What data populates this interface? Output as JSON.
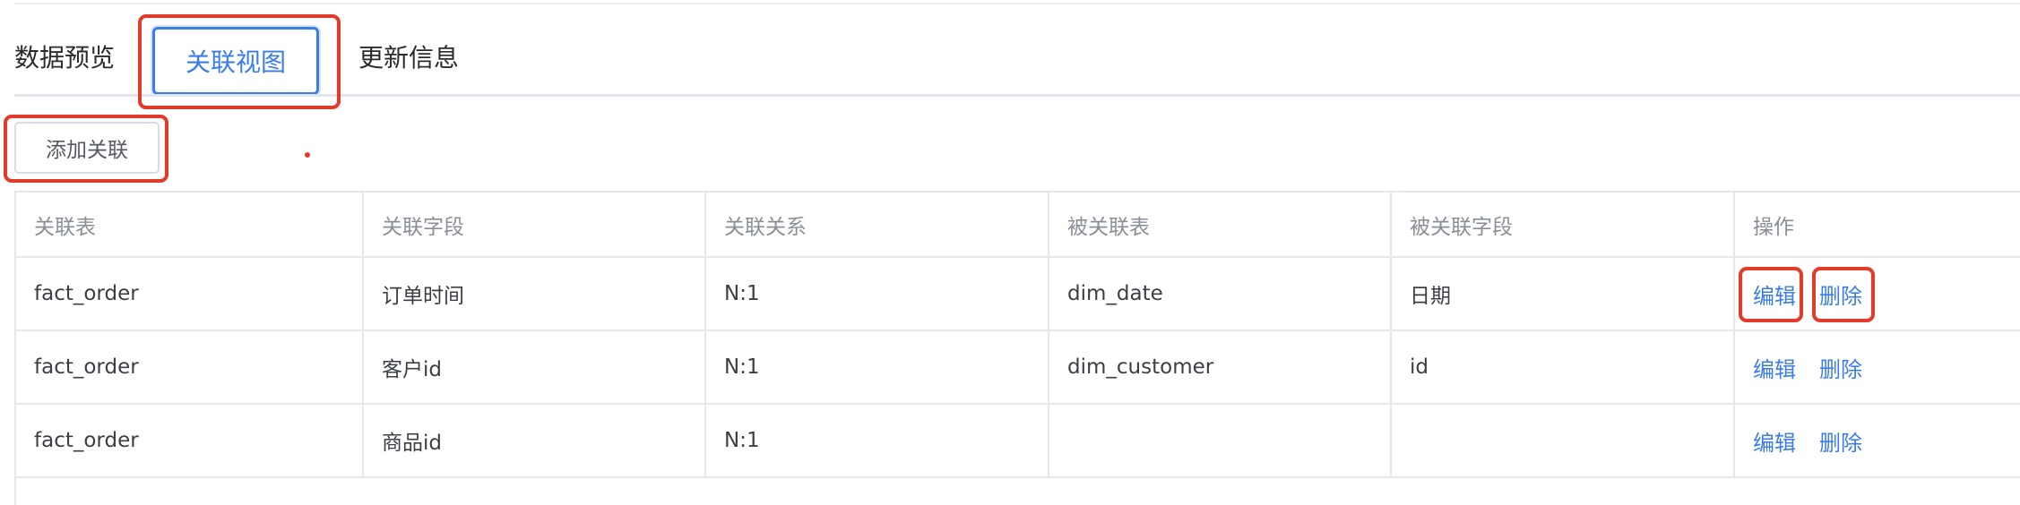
{
  "tabs": [
    {
      "label": "数据预览"
    },
    {
      "label": "关联视图"
    },
    {
      "label": "更新信息"
    }
  ],
  "toolbar": {
    "add_label": "添加关联"
  },
  "table": {
    "headers": [
      "关联表",
      "关联字段",
      "关联关系",
      "被关联表",
      "被关联字段",
      "操作"
    ],
    "rows": [
      {
        "table": "fact_order",
        "field": "订单时间",
        "relation": "N:1",
        "target_table": "dim_date",
        "target_field": "日期"
      },
      {
        "table": "fact_order",
        "field": "客户id",
        "relation": "N:1",
        "target_table": "dim_customer",
        "target_field": "id"
      },
      {
        "table": "fact_order",
        "field": "商品id",
        "relation": "N:1",
        "target_table": "",
        "target_field": ""
      }
    ],
    "actions": {
      "edit": "编辑",
      "delete": "删除"
    }
  },
  "colors": {
    "accent": "#3a7de8",
    "highlight": "#e23b2a",
    "border": "#e4e7ec"
  }
}
